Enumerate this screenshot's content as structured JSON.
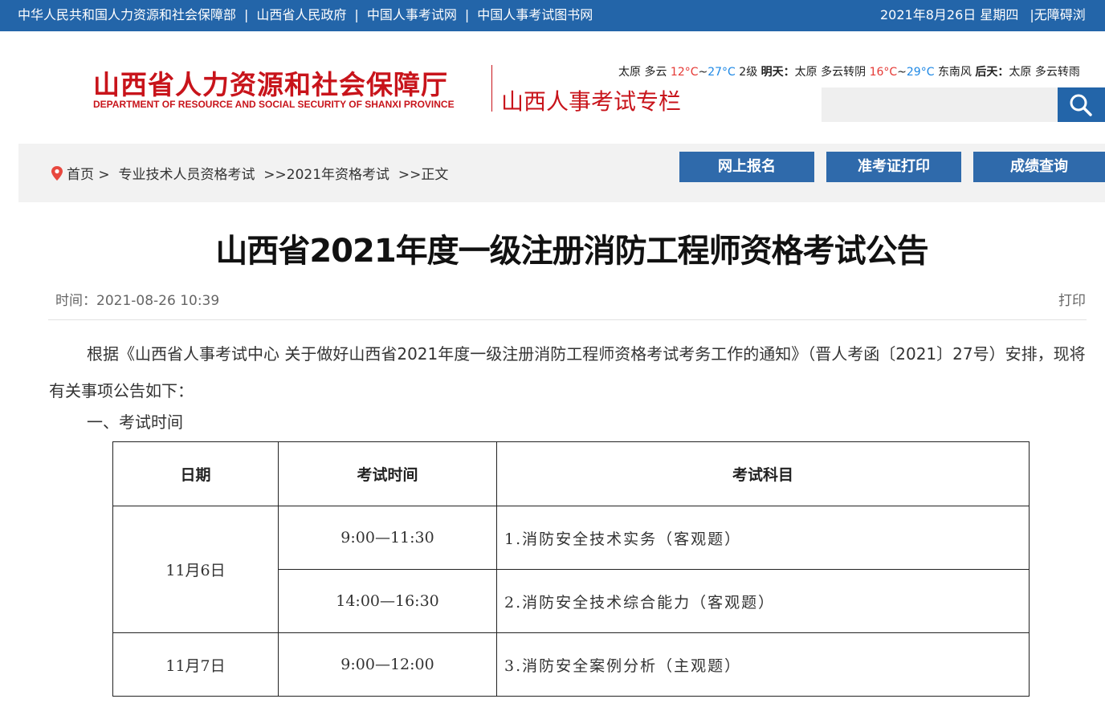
{
  "topbar": {
    "links": [
      "中华人民共和国人力资源和社会保障部",
      "山西省人民政府",
      "中国人事考试网",
      "中国人事考试图书网"
    ],
    "separator": "|",
    "date": "2021年8月26日 星期四",
    "accessibility": "|无障碍浏"
  },
  "header": {
    "logo_cn": "山西省人力资源和社会保障厅",
    "logo_en": "DEPARTMENT OF RESOURCE AND SOCIAL SECURITY OF SHANXI PROVINCE",
    "column_title": "山西人事考试专栏",
    "weather": {
      "today_prefix": "太原 多云",
      "today_low": "12°C",
      "tilde": "~",
      "today_high": "27°C",
      "today_wind": "2级",
      "tomorrow_label": "明天：",
      "tomorrow_desc": "太原 多云转阴",
      "tomorrow_low": "16°C",
      "tomorrow_high": "29°C",
      "tomorrow_wind": "东南风",
      "after_label": "后天：",
      "after_desc": "太原 多云转雨"
    },
    "search_placeholder": ""
  },
  "breadcrumb": {
    "home": "首页 >",
    "level1": "专业技术人员资格考试",
    "level2": ">>2021年资格考试",
    "level3": ">>正文"
  },
  "nav_buttons": [
    "网上报名",
    "准考证打印",
    "成绩查询"
  ],
  "article": {
    "title": "山西省2021年度一级注册消防工程师资格考试公告",
    "time": "时间：2021-08-26 10:39",
    "print": "打印",
    "intro": "根据《山西省人事考试中心 关于做好山西省2021年度一级注册消防工程师资格考试考务工作的通知》（晋人考函〔2021〕27号）安排，现将有关事项公告如下：",
    "section1": "一、考试时间",
    "table": {
      "headers": [
        "日期",
        "考试时间",
        "考试科目"
      ],
      "rows": [
        {
          "date": "11月6日",
          "time": "9:00—11:30",
          "subject": "1.消防安全技术实务（客观题）"
        },
        {
          "date": "",
          "time": "14:00—16:30",
          "subject": "2.消防安全技术综合能力（客观题）"
        },
        {
          "date": "11月7日",
          "time": "9:00—12:00",
          "subject": "3.消防安全案例分析（主观题）"
        }
      ]
    }
  },
  "colors": {
    "brand_blue": "#2365a9",
    "brand_red": "#c8141b",
    "crumb_bg": "#f2f2f2"
  }
}
